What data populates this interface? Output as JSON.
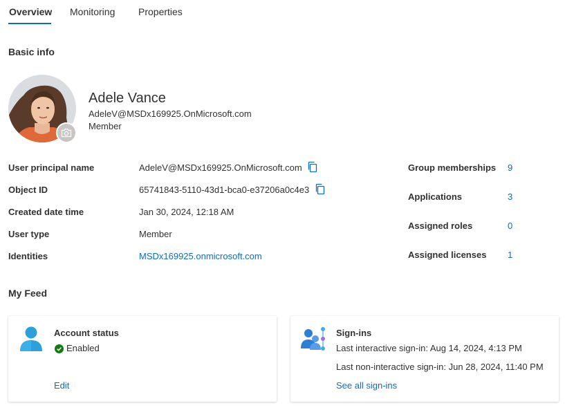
{
  "tabs": [
    {
      "label": "Overview",
      "active": true
    },
    {
      "label": "Monitoring",
      "active": false
    },
    {
      "label": "Properties",
      "active": false
    }
  ],
  "basic_info": {
    "title": "Basic info",
    "user": {
      "name": "Adele Vance",
      "email": "AdeleV@MSDx169925.OnMicrosoft.com",
      "type": "Member"
    },
    "properties": {
      "upn_label": "User principal name",
      "upn_value": "AdeleV@MSDx169925.OnMicrosoft.com",
      "object_id_label": "Object ID",
      "object_id_value": "65741843-5110-43d1-bca0-e37206a0c4e3",
      "created_label": "Created date time",
      "created_value": "Jan 30, 2024, 12:18 AM",
      "user_type_label": "User type",
      "user_type_value": "Member",
      "identities_label": "Identities",
      "identities_value": "MSDx169925.onmicrosoft.com"
    },
    "stats": {
      "group_label": "Group memberships",
      "group_value": "9",
      "apps_label": "Applications",
      "apps_value": "3",
      "roles_label": "Assigned roles",
      "roles_value": "0",
      "licenses_label": "Assigned licenses",
      "licenses_value": "1"
    }
  },
  "my_feed": {
    "title": "My Feed",
    "account_status": {
      "title": "Account status",
      "status": "Enabled",
      "edit_label": "Edit"
    },
    "sign_ins": {
      "title": "Sign-ins",
      "last_interactive": "Last interactive sign-in: Aug 14, 2024, 4:13 PM",
      "last_non_interactive": "Last non-interactive sign-in: Jun 28, 2024, 11:40 PM",
      "see_all_label": "See all sign-ins"
    }
  },
  "colors": {
    "accent": "#0f6cbd",
    "success": "#107c10",
    "user_icon": "#2da0dc"
  },
  "icons": [
    "copy-icon",
    "camera-icon",
    "user-icon",
    "check-circle-icon",
    "sign-in-icon"
  ]
}
